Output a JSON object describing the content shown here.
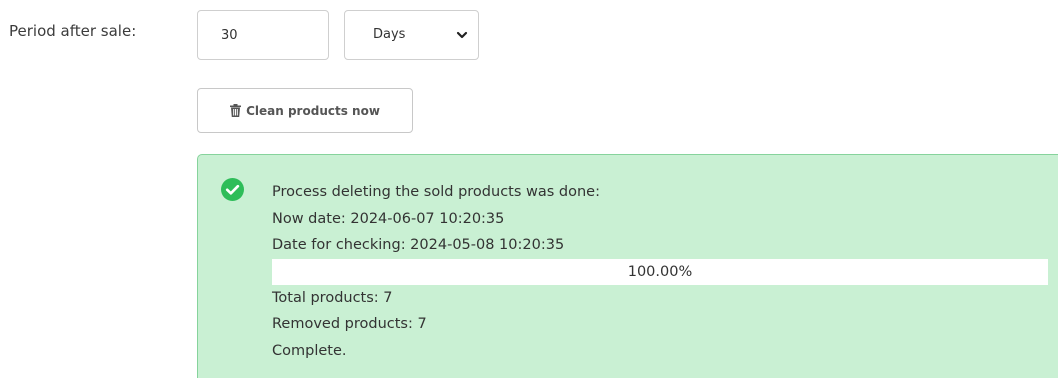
{
  "form": {
    "period_label": "Period after sale:",
    "period_value": "30",
    "unit_selected": "Days",
    "clean_button_label": "Clean products now"
  },
  "result": {
    "status_icon": "check-circle-icon",
    "heading": "Process deleting the sold products was done:",
    "now_date": "Now date: 2024-06-07 10:20:35",
    "date_for_checking": "Date for checking: 2024-05-08 10:20:35",
    "progress_percent": 100,
    "progress_text": "100.00%",
    "total_products": "Total products: 7",
    "removed_products": "Removed products: 7",
    "status_text": "Complete."
  },
  "colors": {
    "success_bg": "#c9f0d3",
    "success_border": "#86d39c",
    "success_icon": "#2ebd59"
  }
}
